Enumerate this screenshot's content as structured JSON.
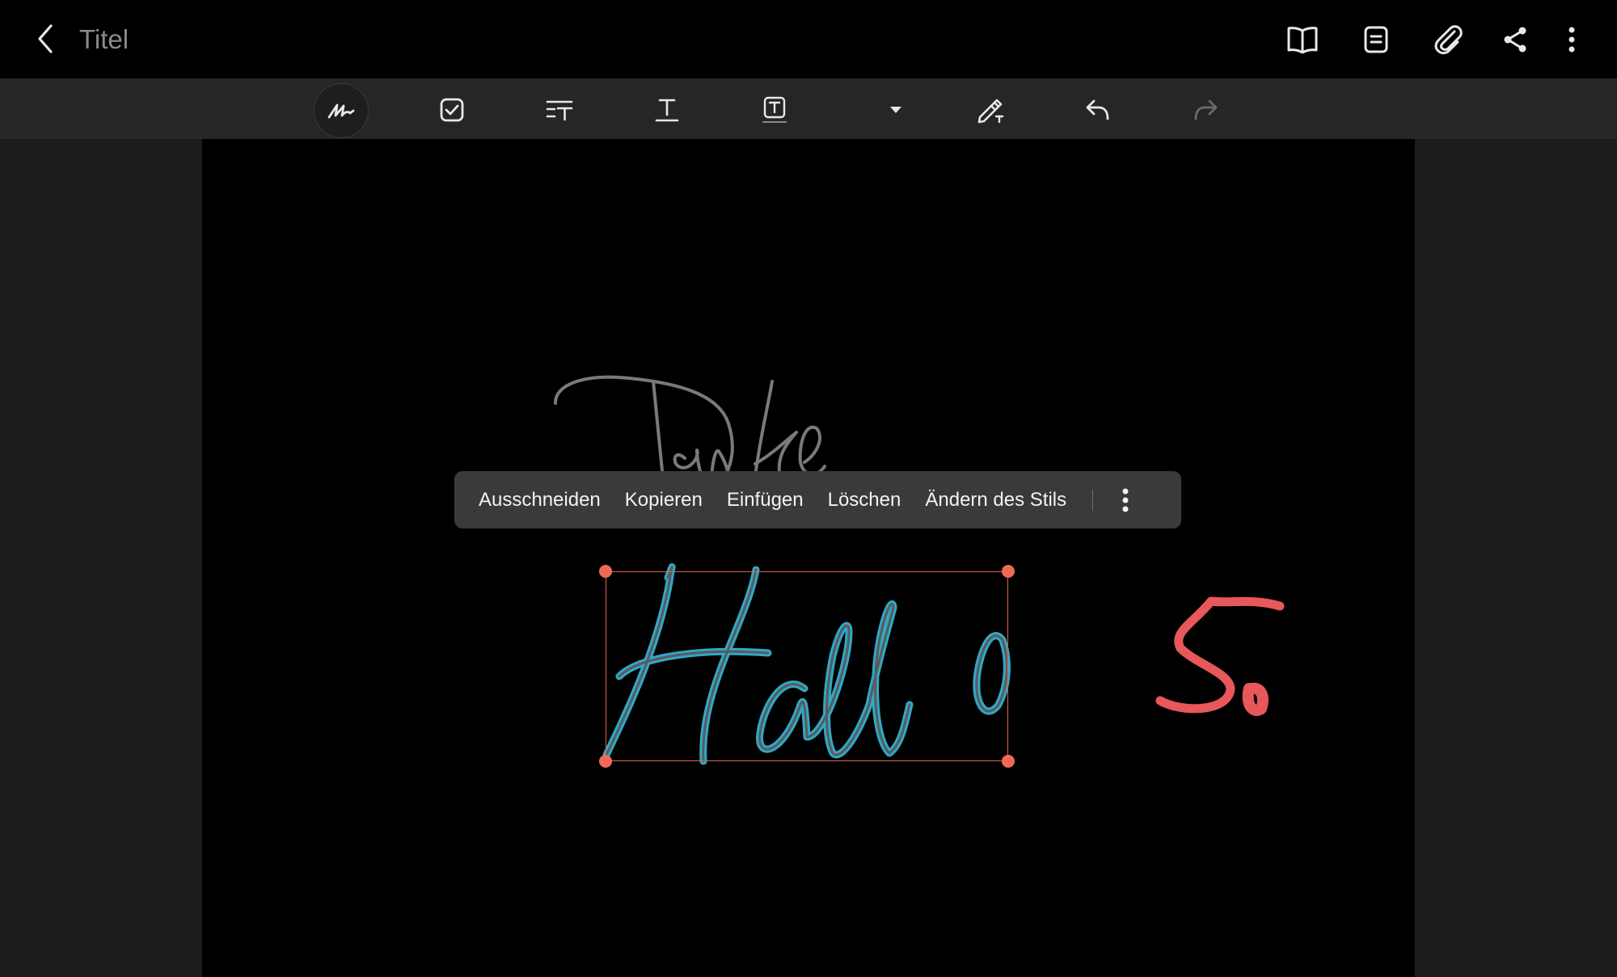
{
  "header": {
    "title": "Titel",
    "icons": [
      "back-arrow-icon",
      "book-view-icon",
      "page-list-icon",
      "attachment-icon",
      "share-icon",
      "more-options-icon"
    ]
  },
  "toolbar": {
    "tools": [
      "handwriting-pen-icon",
      "checkbox-icon",
      "text-format-icon",
      "text-icon",
      "text-box-icon",
      "dropdown-arrow-icon",
      "eraser-pen-icon",
      "undo-icon",
      "redo-icon"
    ],
    "active_tool": "handwriting-pen",
    "redo_enabled": false
  },
  "canvas": {
    "handwriting": [
      {
        "text": "Danke",
        "color": "#7a7a7a"
      },
      {
        "text": "Hallo",
        "color": "#2fa9c8",
        "selected": true
      },
      {
        "text": "S.",
        "color": "#e8585a"
      }
    ]
  },
  "context_menu": {
    "cut": "Ausschneiden",
    "copy": "Kopieren",
    "paste": "Einfügen",
    "delete": "Löschen",
    "change_style": "Ändern des Stils"
  },
  "colors": {
    "selection": "#e0604d",
    "background": "#000000",
    "toolbar": "#262626"
  }
}
